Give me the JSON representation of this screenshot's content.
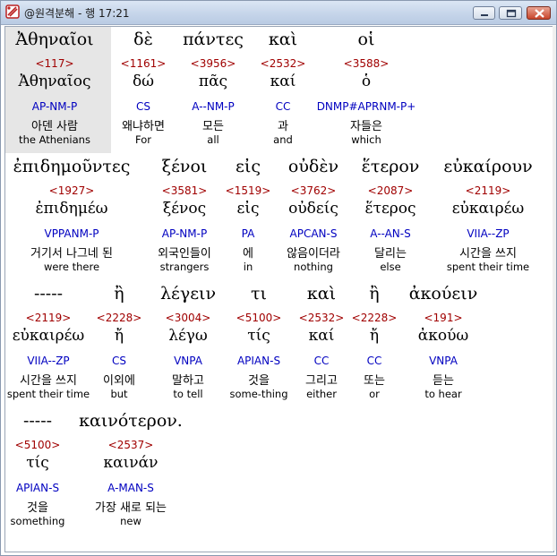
{
  "window": {
    "title": "@원격분해 - 행 17:21",
    "icon": "app-icon",
    "controls": [
      "minimize-icon",
      "maximize-icon",
      "close-icon"
    ]
  },
  "rows": [
    {
      "words": [
        {
          "greek": "Ἀθηναῖοι",
          "strong": "<117>",
          "lemma": "Ἀθηναῖος",
          "parse": "AP-NM-P",
          "korean": "아덴 사람",
          "english": "the Athenians"
        },
        {
          "greek": "δὲ",
          "strong": "<1161>",
          "lemma": "δώ",
          "parse": "CS",
          "korean": "왜냐하면",
          "english": "For"
        },
        {
          "greek": "πάντες",
          "strong": "<3956>",
          "lemma": "πᾶς",
          "parse": "A--NM-P",
          "korean": "모든",
          "english": "all"
        },
        {
          "greek": "καὶ",
          "strong": "<2532>",
          "lemma": "καί",
          "parse": "CC",
          "korean": "과",
          "english": "and"
        },
        {
          "greek": "οἱ",
          "strong": "<3588>",
          "lemma": "ὁ",
          "parse": "DNMP#APRNM-P+",
          "korean": "자들은",
          "english": "which"
        }
      ]
    },
    {
      "words": [
        {
          "greek": "ἐπιδημοῦντες",
          "strong": "<1927>",
          "lemma": "ἐπιδημέω",
          "parse": "VPPANM-P",
          "korean": "거기서 나그네 된",
          "english": "were there"
        },
        {
          "greek": "ξένοι",
          "strong": "<3581>",
          "lemma": "ξένος",
          "parse": "AP-NM-P",
          "korean": "외국인들이",
          "english": "strangers"
        },
        {
          "greek": "εἰς",
          "strong": "<1519>",
          "lemma": "εἰς",
          "parse": "PA",
          "korean": "에",
          "english": "in"
        },
        {
          "greek": "οὐδὲν",
          "strong": "<3762>",
          "lemma": "οὐδείς",
          "parse": "APCAN-S",
          "korean": "않음이더라",
          "english": "nothing"
        },
        {
          "greek": "ἕτερον",
          "strong": "<2087>",
          "lemma": "ἕτερος",
          "parse": "A--AN-S",
          "korean": "달리는",
          "english": "else"
        },
        {
          "greek": "εὐκαίρουν",
          "strong": "<2119>",
          "lemma": "εὐκαιρέω",
          "parse": "VIIA--ZP",
          "korean": "시간을 쓰지",
          "english": "spent their time"
        }
      ]
    },
    {
      "words": [
        {
          "greek": "-----",
          "strong": "<2119>",
          "lemma": "εὐκαιρέω",
          "parse": "VIIA--ZP",
          "korean": "시간을 쓰지",
          "english": "spent their time"
        },
        {
          "greek": "ἢ",
          "strong": "<2228>",
          "lemma": "ἤ",
          "parse": "CS",
          "korean": "이외에",
          "english": "but"
        },
        {
          "greek": "λέγειν",
          "strong": "<3004>",
          "lemma": "λέγω",
          "parse": "VNPA",
          "korean": "말하고",
          "english": "to tell"
        },
        {
          "greek": "τι",
          "strong": "<5100>",
          "lemma": "τίς",
          "parse": "APIAN-S",
          "korean": "것을",
          "english": "some-thing"
        },
        {
          "greek": "καὶ",
          "strong": "<2532>",
          "lemma": "καί",
          "parse": "CC",
          "korean": "그리고",
          "english": "either"
        },
        {
          "greek": "ἢ",
          "strong": "<2228>",
          "lemma": "ἤ",
          "parse": "CC",
          "korean": "또는",
          "english": "or"
        },
        {
          "greek": "ἀκούειν",
          "strong": "<191>",
          "lemma": "ἀκούω",
          "parse": "VNPA",
          "korean": "듣는",
          "english": "to hear"
        }
      ]
    },
    {
      "words": [
        {
          "greek": "-----",
          "strong": "<5100>",
          "lemma": "τίς",
          "parse": "APIAN-S",
          "korean": "것을",
          "english": "something"
        },
        {
          "greek": "καινότερον.",
          "strong": "<2537>",
          "lemma": "καινάν",
          "parse": "A-MAN-S",
          "korean": "가장 새로 되는",
          "english": "new"
        }
      ]
    }
  ]
}
